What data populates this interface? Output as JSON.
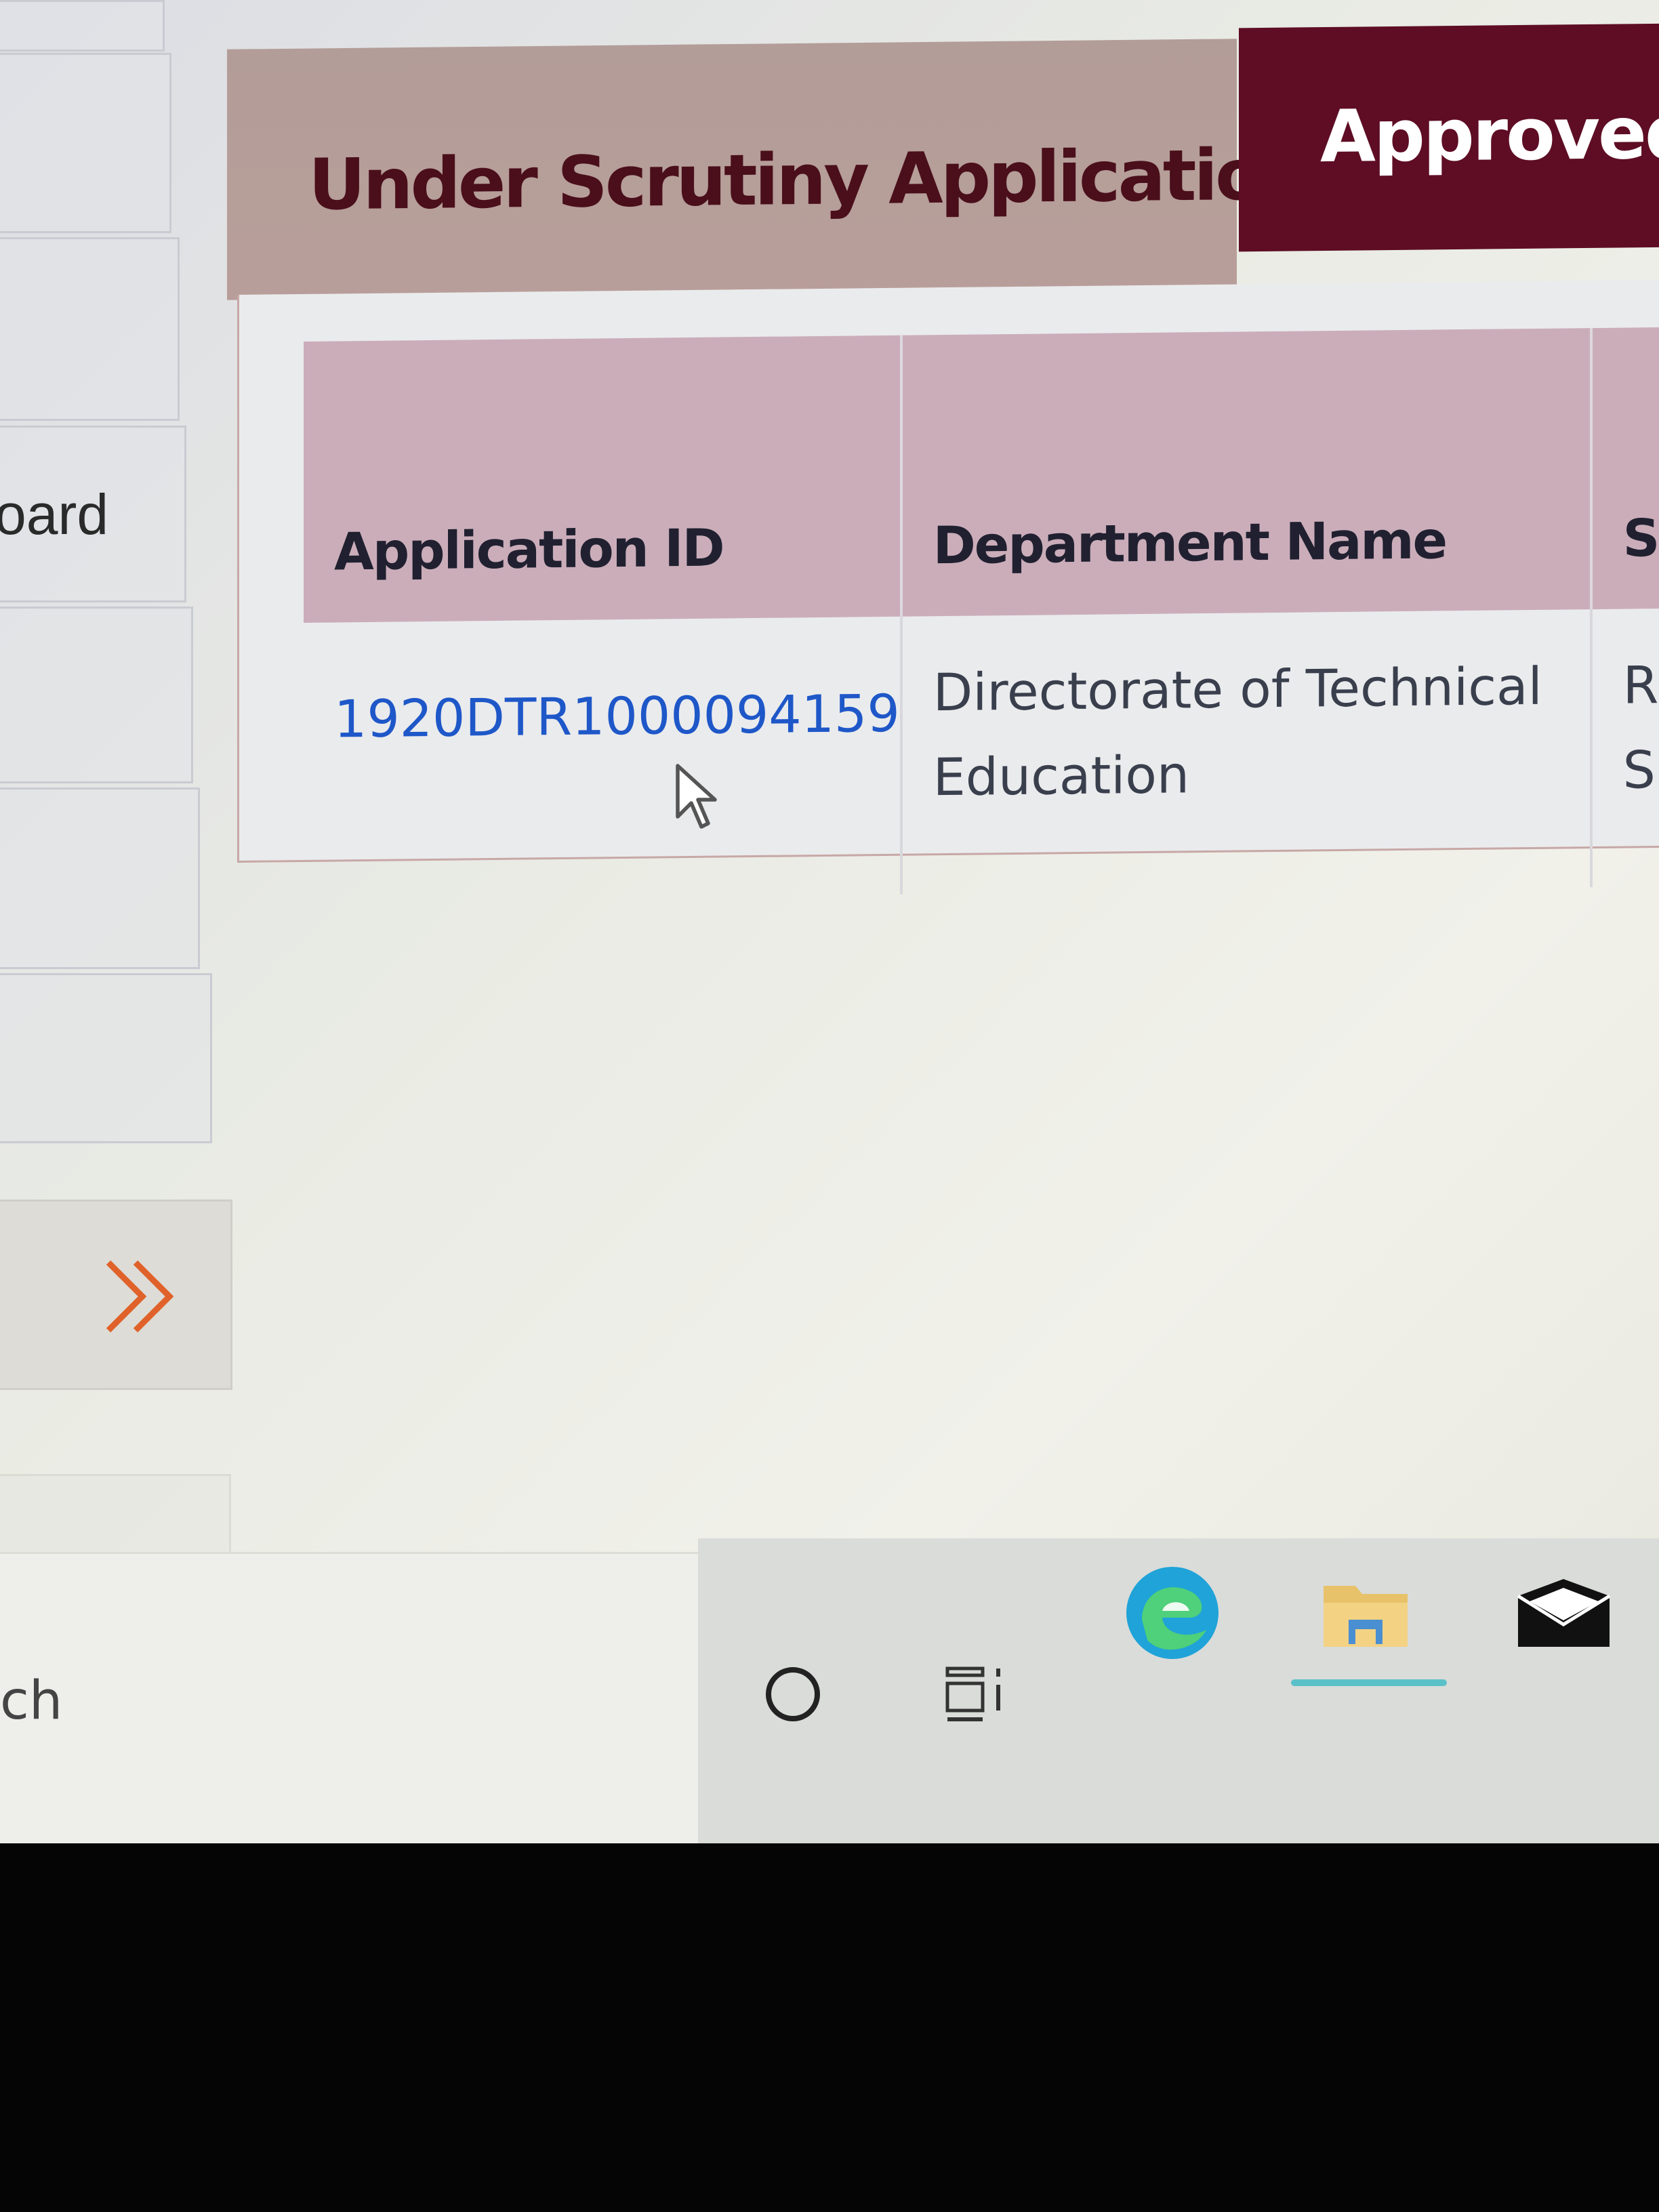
{
  "sidebar": {
    "items": [
      {
        "label": ""
      },
      {
        "label": ""
      },
      {
        "label": "oard"
      },
      {
        "label": ""
      },
      {
        "label": ""
      },
      {
        "label": ""
      }
    ],
    "collapse_icon": "double-chevron-right-icon",
    "collapse_color": "#e0622a"
  },
  "tabs": [
    {
      "label": "Under Scrutiny Applications",
      "active": true
    },
    {
      "label": "Approved /",
      "active": false
    }
  ],
  "table": {
    "columns": [
      "Application ID",
      "Department Name",
      "S"
    ],
    "rows": [
      {
        "application_id": "1920DTR1000094159",
        "department_line1": "Directorate of Technical",
        "department_line2": "Education",
        "status_line1": "R",
        "status_line2": "S"
      }
    ]
  },
  "taskbar": {
    "search_text": "ch",
    "icons": [
      "cortana-circle-icon",
      "task-view-icon",
      "edge-browser-icon",
      "file-explorer-icon",
      "mail-icon"
    ]
  },
  "colors": {
    "tab_active_bg": "#b39d98",
    "tab_active_text": "#4a0f1b",
    "tab_inactive_bg": "#5e0d24",
    "header_bg": "#cbadba",
    "link": "#1e57c8"
  }
}
